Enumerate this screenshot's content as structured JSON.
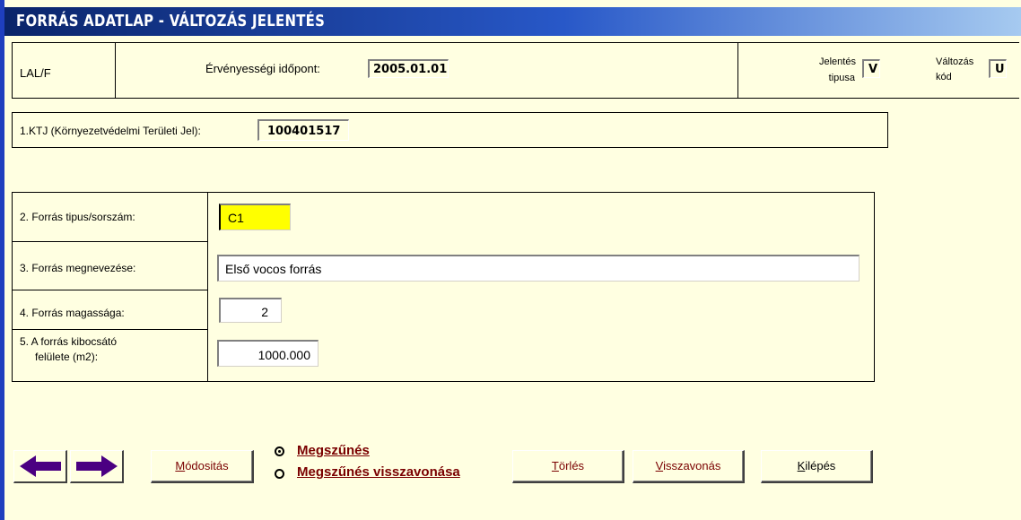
{
  "title": "FORRÁS ADATLAP - VÁLTOZÁS JELENTÉS",
  "header": {
    "code": "LAL/F",
    "validity_label": "Érvényességi időpont:",
    "validity_value": "2005.01.01",
    "report_type_label_1": "Jelentés",
    "report_type_label_2": "tipusa",
    "report_type_value": "V",
    "change_code_label_1": "Változás",
    "change_code_label_2": "kód",
    "change_code_value": "U"
  },
  "ktj": {
    "label": "1.KTJ (Környezetvédelmi Területi Jel):",
    "value": "100401517"
  },
  "form": {
    "type_label": "2. Forrás tipus/sorszám:",
    "type_value": "C1",
    "name_label": "3. Forrás megnevezése:",
    "name_value": "Első vocos forrás",
    "height_label": "4. Forrás magassága:",
    "height_value": "2",
    "surface_label_1": "5. A forrás kibocsátó",
    "surface_label_2": "felülete (m2):",
    "surface_value": "1000.000"
  },
  "buttons": {
    "modify_first": "M",
    "modify_rest": "ódositás",
    "delete_first": "T",
    "delete_rest": "örlés",
    "revoke_first": "V",
    "revoke_rest": "isszavonás",
    "exit_first": "K",
    "exit_rest": "ilépés"
  },
  "radios": {
    "option1_first": "M",
    "option1_rest": "egszűnés",
    "option2_first": "M",
    "option2_rest": "egszűnés visszavonása",
    "selected": "option1"
  },
  "icons": {
    "prev": "left-arrow-icon",
    "next": "right-arrow-icon"
  },
  "colors": {
    "background": "#FFFFE1",
    "accent": "#7A0000",
    "arrow": "#4B0082",
    "highlight_field": "#FFFF00"
  }
}
